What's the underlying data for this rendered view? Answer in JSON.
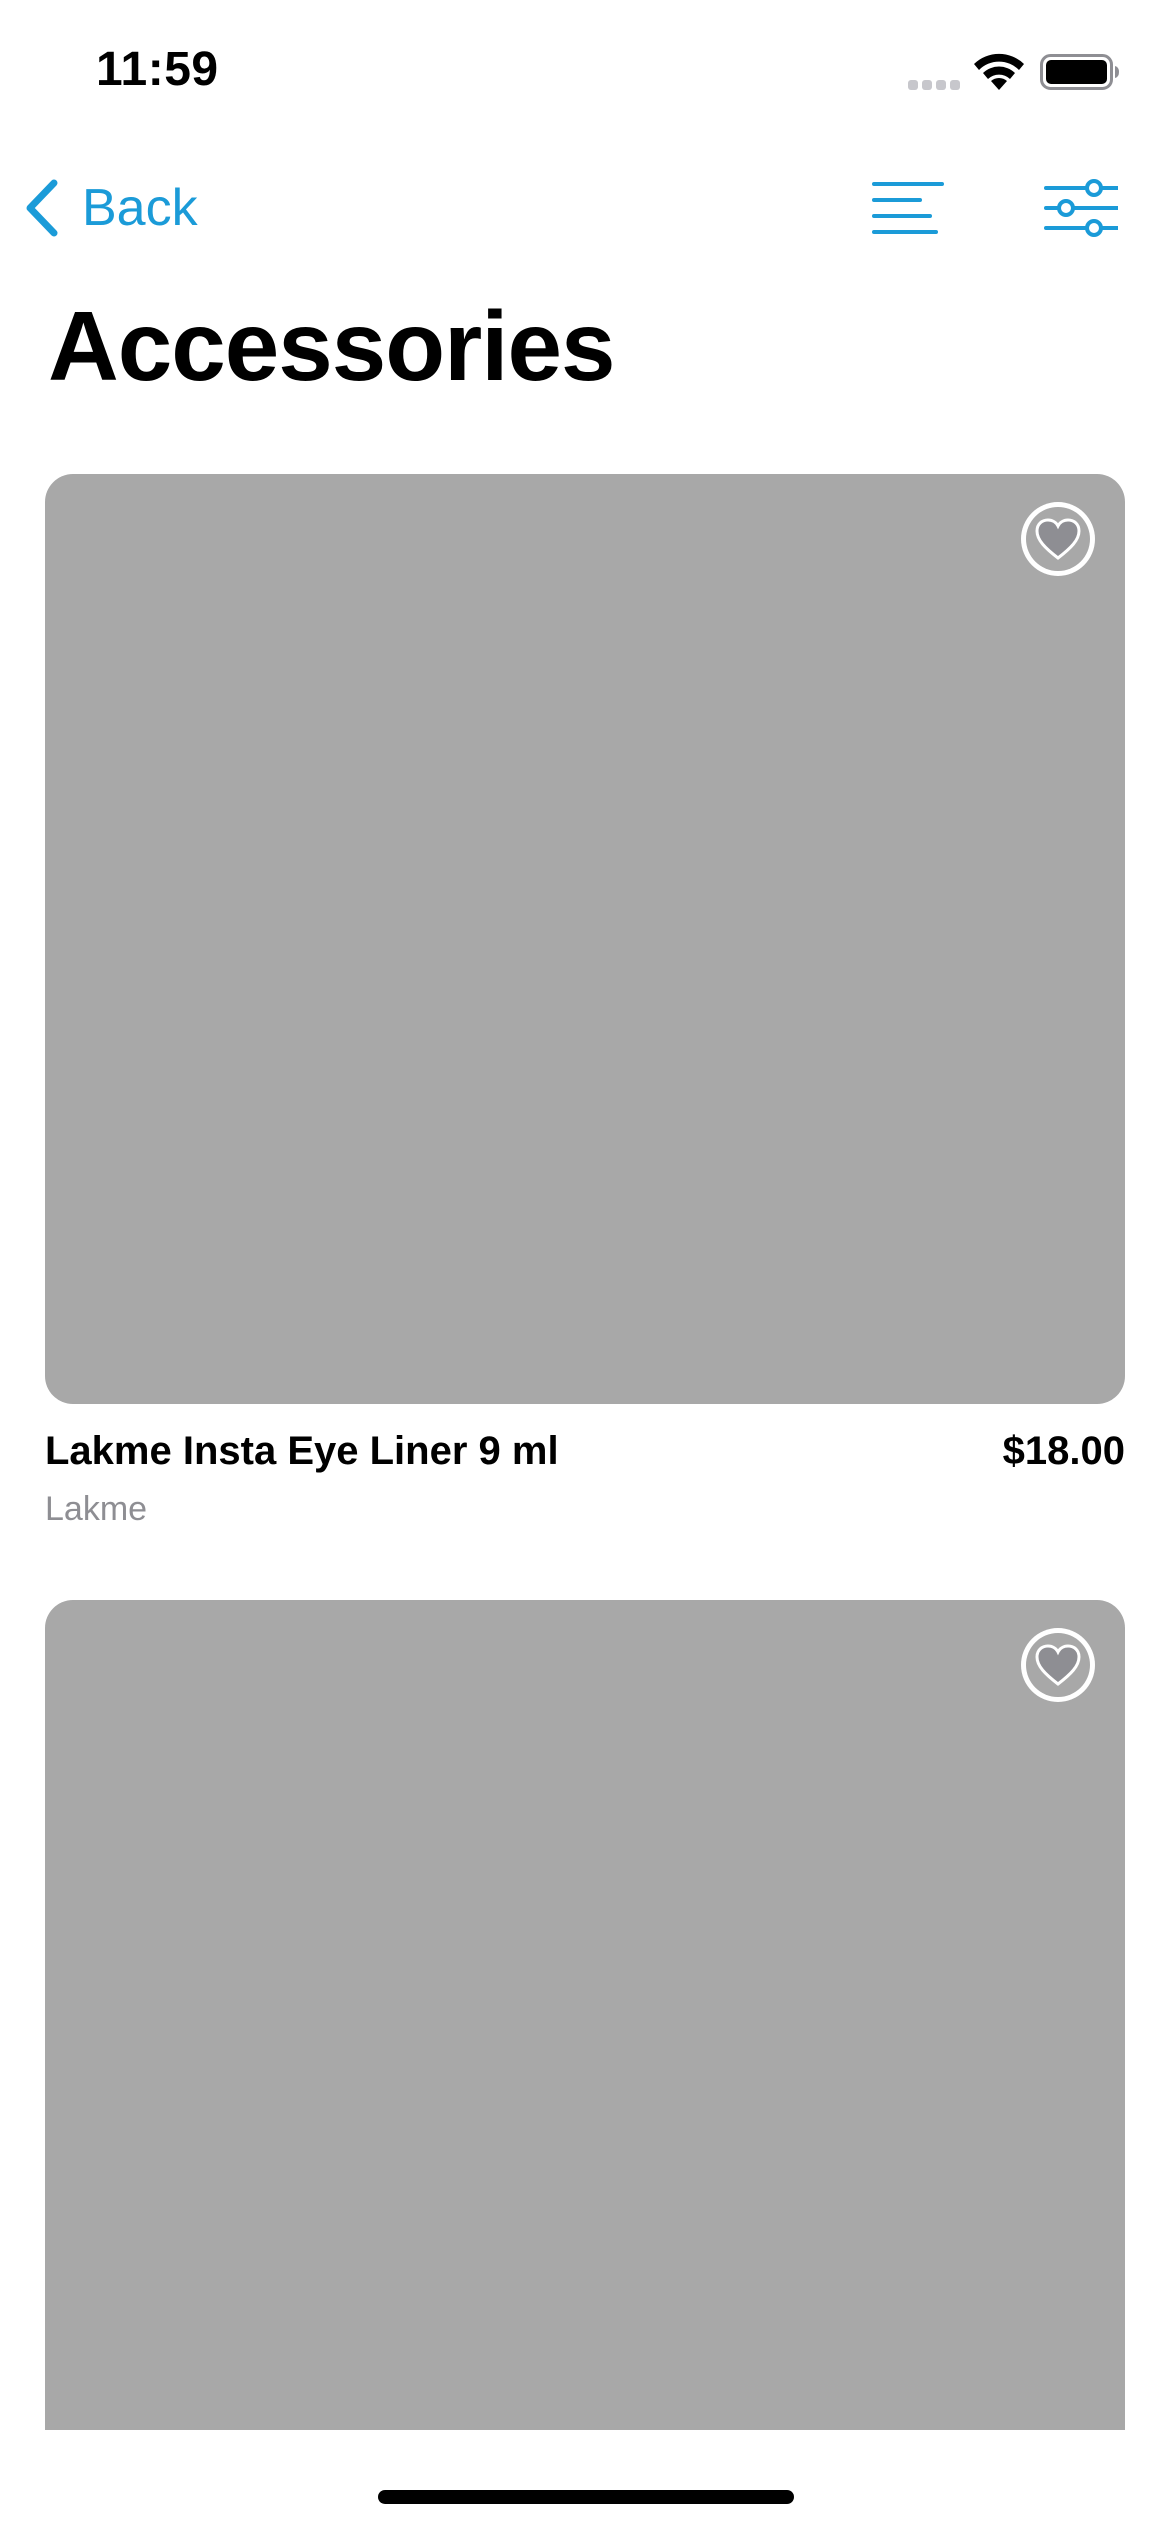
{
  "status_bar": {
    "time": "11:59"
  },
  "nav": {
    "back_label": "Back",
    "back_icon": "chevron-left-icon",
    "sort_icon": "sort-lines-icon",
    "filter_icon": "sliders-icon",
    "accent_color": "#1b9bd8"
  },
  "page": {
    "title": "Accessories"
  },
  "products": [
    {
      "name": "Lakme Insta Eye Liner 9 ml",
      "price": "$18.00",
      "brand": "Lakme",
      "favorite_icon": "heart-icon",
      "image_placeholder_color": "#a8a8a8"
    },
    {
      "favorite_icon": "heart-icon",
      "image_placeholder_color": "#a8a8a8"
    }
  ]
}
